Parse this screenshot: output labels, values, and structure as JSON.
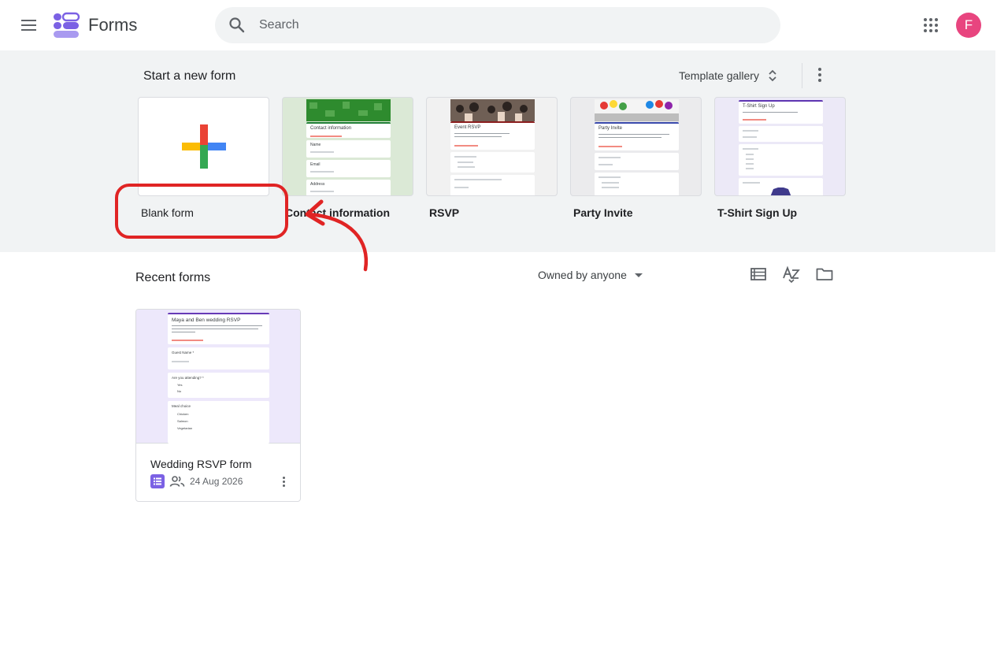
{
  "app": {
    "title": "Forms",
    "avatar_letter": "F",
    "avatar_color": "#e8457f",
    "accent": "#7b61e4"
  },
  "search": {
    "placeholder": "Search"
  },
  "templates_section": {
    "title": "Start a new form",
    "gallery_label": "Template gallery",
    "items": [
      {
        "label": "Blank form"
      },
      {
        "label": "Contact information",
        "thumb_title": "Contact information",
        "field_labels": [
          "Name",
          "Email",
          "Address"
        ]
      },
      {
        "label": "RSVP",
        "thumb_title": "Event RSVP"
      },
      {
        "label": "Party Invite",
        "thumb_title": "Party Invite"
      },
      {
        "label": "T-Shirt Sign Up",
        "thumb_title": "T-Shirt Sign Up"
      }
    ]
  },
  "recent": {
    "title": "Recent forms",
    "owner_filter": "Owned by anyone",
    "forms": [
      {
        "name": "Wedding RSVP form",
        "date": "24 Aug 2026",
        "thumb_title": "Maya and Ben wedding RSVP",
        "thumb_questions": [
          "Guest Name *",
          "Are you attending? *",
          "Meal choice"
        ],
        "thumb_options": [
          "Yes",
          "No",
          "Chicken",
          "Salmon",
          "Vegetarian"
        ]
      }
    ]
  },
  "annotation_color": "#e02424"
}
